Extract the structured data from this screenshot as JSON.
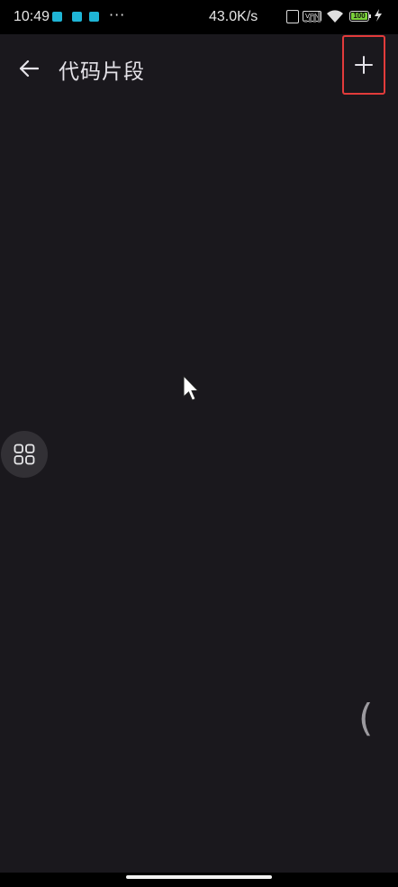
{
  "status_bar": {
    "time": "10:49",
    "notification_icons": [
      "app-notification-icon",
      "app-notification-icon",
      "app-notification-icon"
    ],
    "more": "···",
    "net_speed": "43.0K/s",
    "vpn": "VPN",
    "battery_level": "100",
    "battery_color": "#7bd13a"
  },
  "app_bar": {
    "back_icon": "arrow-left-icon",
    "title": "代码片段",
    "add_icon": "plus-icon",
    "highlight_color": "#e23b3b"
  },
  "content": {
    "floating_button_icon": "grid-icon",
    "edge_glyph": "("
  }
}
